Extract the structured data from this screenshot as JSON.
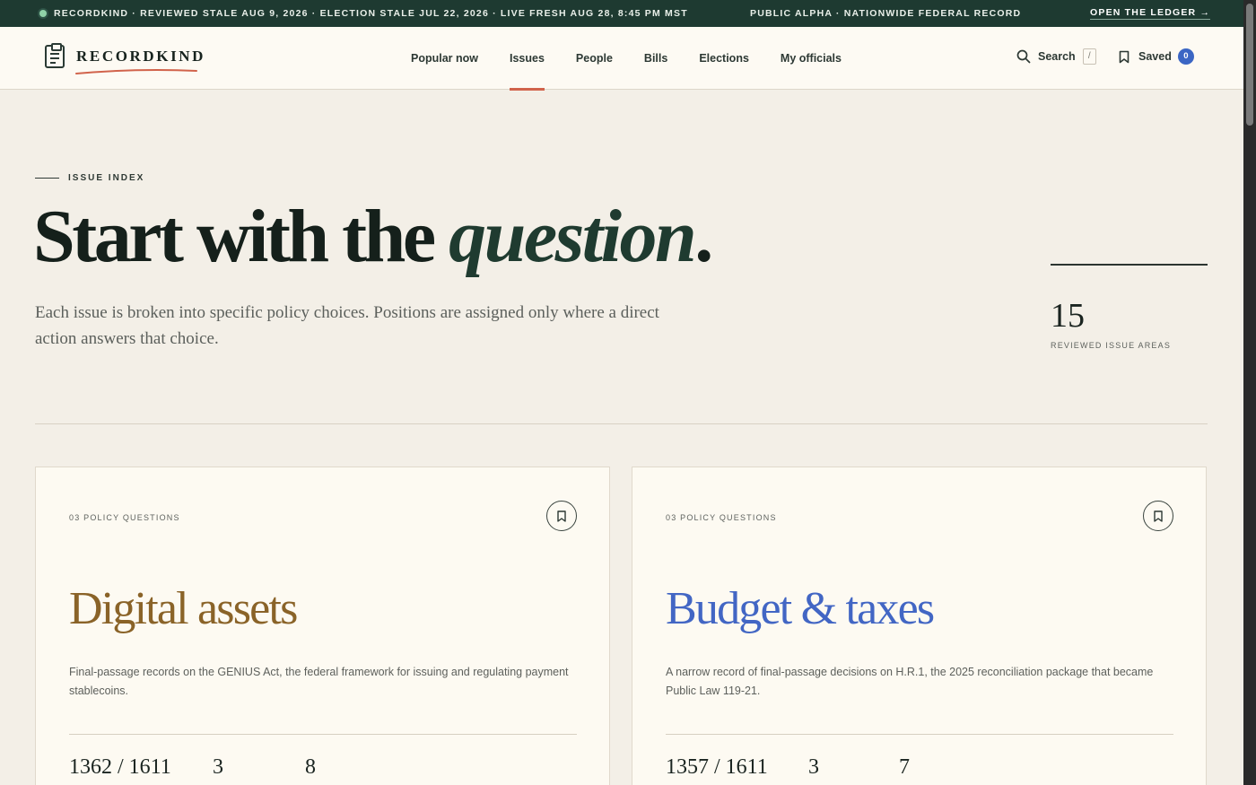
{
  "ticker": {
    "status": "RECORDKIND · REVIEWED STALE AUG 9, 2026 · ELECTION STALE JUL 22, 2026 · LIVE FRESH AUG 28, 8:45 PM MST",
    "scope": "PUBLIC ALPHA · NATIONWIDE FEDERAL RECORD",
    "ledger_link": "OPEN THE LEDGER →"
  },
  "header": {
    "brand": "RECORDKIND",
    "nav": [
      "Popular now",
      "Issues",
      "People",
      "Bills",
      "Elections",
      "My officials"
    ],
    "active_nav": "Issues",
    "search_label": "Search",
    "search_shortcut": "/",
    "saved_label": "Saved",
    "saved_count": "0"
  },
  "hero": {
    "eyebrow": "ISSUE INDEX",
    "title_plain": "Start with the ",
    "title_emph": "question",
    "title_end": ".",
    "subtitle": "Each issue is broken into specific policy choices. Positions are assigned only where a direct action answers that choice.",
    "stat_value": "15",
    "stat_label": "REVIEWED ISSUE AREAS"
  },
  "cards": [
    {
      "count": "03 POLICY QUESTIONS",
      "title": "Digital assets",
      "description": "Final-passage records on the GENIUS Act, the federal framework for issuing and regulating payment stablecoins.",
      "metric_1": "1362 / 1611",
      "metric_2": "3",
      "metric_3": "8"
    },
    {
      "count": "03 POLICY QUESTIONS",
      "title": "Budget & taxes",
      "description": "A narrow record of final-passage decisions on H.R.1, the 2025 reconciliation package that became Public Law 119-21.",
      "metric_1": "1357 / 1611",
      "metric_2": "3",
      "metric_3": "7"
    }
  ],
  "colors": {
    "ticker_bg": "#1e3a31",
    "accent_underline": "#d1634b",
    "badge": "#3b66c4",
    "digital_assets_title": "#8a6328",
    "budget_title": "#4266c4"
  }
}
